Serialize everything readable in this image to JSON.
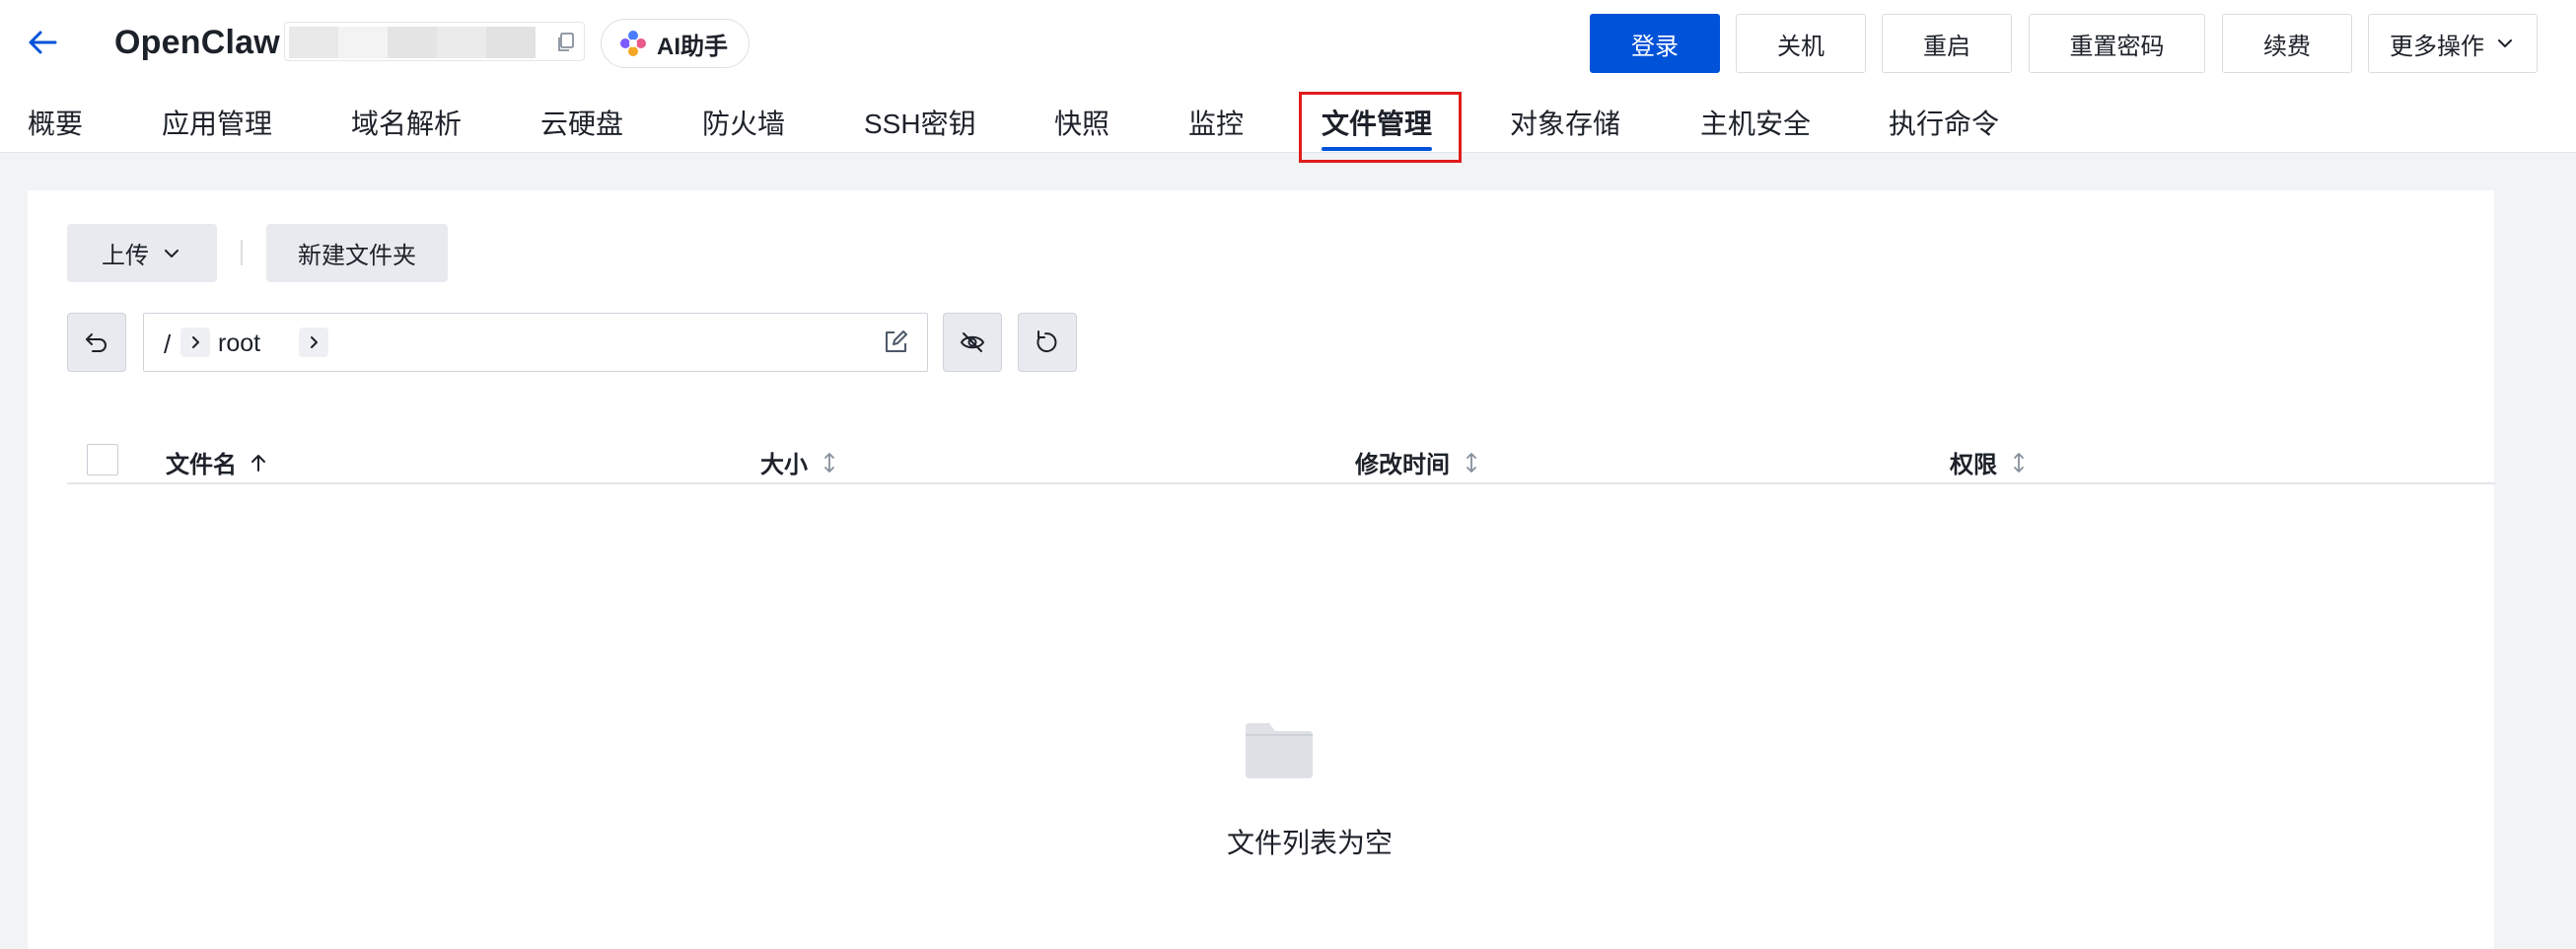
{
  "header": {
    "title": "OpenClaw",
    "ai_button": "AI助手",
    "actions": {
      "login": "登录",
      "shutdown": "关机",
      "restart": "重启",
      "reset_password": "重置密码",
      "renew": "续费",
      "more": "更多操作"
    }
  },
  "tabs": [
    "概要",
    "应用管理",
    "域名解析",
    "云硬盘",
    "防火墙",
    "SSH密钥",
    "快照",
    "监控",
    "文件管理",
    "对象存储",
    "主机安全",
    "执行命令"
  ],
  "active_tab": "文件管理",
  "toolbar": {
    "upload": "上传",
    "new_folder": "新建文件夹"
  },
  "path": {
    "root": "/",
    "segment": "root"
  },
  "table": {
    "columns": {
      "name": "文件名",
      "size": "大小",
      "modified": "修改时间",
      "permission": "权限"
    }
  },
  "empty_text": "文件列表为空",
  "colors": {
    "primary": "#0052d9",
    "highlight_border": "#e01c1c",
    "page_bg": "#f2f3f5"
  }
}
